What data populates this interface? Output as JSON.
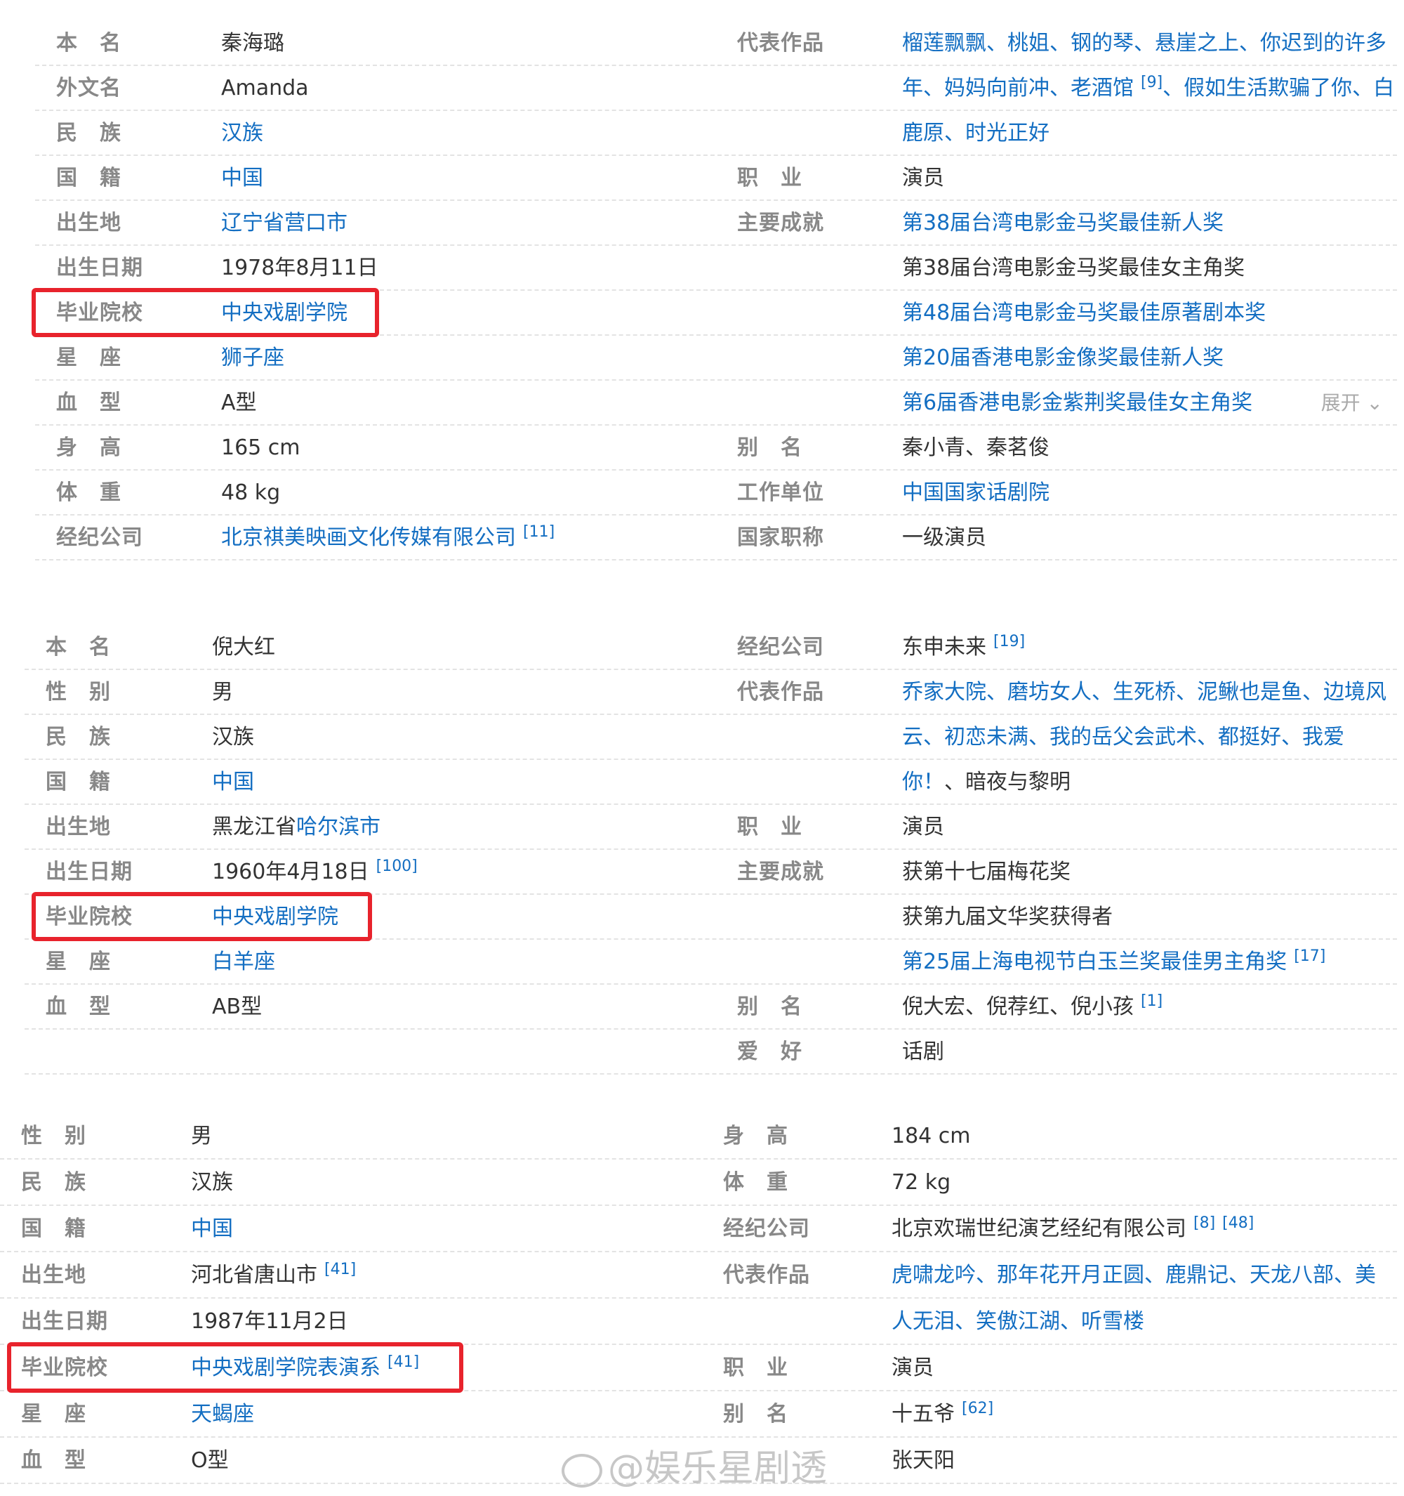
{
  "watermark": "@娱乐星剧透",
  "expand_label": "展开",
  "cards": [
    {
      "left": [
        {
          "label": "本　名",
          "value": "秦海璐",
          "link": false
        },
        {
          "label": "外文名",
          "value": "Amanda",
          "link": false
        },
        {
          "label": "民　族",
          "value": "汉族",
          "link": true
        },
        {
          "label": "国　籍",
          "value": "中国",
          "link": true
        },
        {
          "label": "出生地",
          "value": "辽宁省营口市",
          "link": true
        },
        {
          "label": "出生日期",
          "value": "1978年8月11日",
          "link": false
        },
        {
          "label": "毕业院校",
          "value": "中央戏剧学院",
          "link": true
        },
        {
          "label": "星　座",
          "value": "狮子座",
          "link": true
        },
        {
          "label": "血　型",
          "value": "A型",
          "link": false
        },
        {
          "label": "身　高",
          "value": "165 cm",
          "link": false
        },
        {
          "label": "体　重",
          "value": "48 kg",
          "link": false
        },
        {
          "label": "经纪公司",
          "value": "北京祺美映画文化传媒有限公司",
          "link": true,
          "ref": "[11]"
        }
      ],
      "right": [
        {
          "label": "代表作品",
          "value": "榴莲飘飘、桃姐、钢的琴、悬崖之上、你迟到的许多",
          "link": true
        },
        {
          "label": "",
          "value": "年、妈妈向前冲、老酒馆",
          "link": true,
          "ref": "[9]",
          "value2": "、假如生活欺骗了你、白"
        },
        {
          "label": "",
          "value": "鹿原、时光正好",
          "link": true
        },
        {
          "label": "职　业",
          "value": "演员",
          "link": false
        },
        {
          "label": "主要成就",
          "value": "第38届台湾电影金马奖最佳新人奖",
          "link": true
        },
        {
          "label": "",
          "value": "第38届台湾电影金马奖最佳女主角奖",
          "link": false
        },
        {
          "label": "",
          "value": "第48届台湾电影金马奖最佳原著剧本奖",
          "link": true
        },
        {
          "label": "",
          "value": "第20届香港电影金像奖最佳新人奖",
          "link": true
        },
        {
          "label": "",
          "value": "第6届香港电影金紫荆奖最佳女主角奖",
          "link": true,
          "expand": true
        },
        {
          "label": "别　名",
          "value": "秦小青、秦茗俊",
          "link": false
        },
        {
          "label": "工作单位",
          "value": "中国国家话剧院",
          "link": true
        },
        {
          "label": "国家职称",
          "value": "一级演员",
          "link": false
        }
      ]
    },
    {
      "left": [
        {
          "label": "本　名",
          "value": "倪大红",
          "link": false
        },
        {
          "label": "性　别",
          "value": "男",
          "link": false
        },
        {
          "label": "民　族",
          "value": "汉族",
          "link": false
        },
        {
          "label": "国　籍",
          "value": "中国",
          "link": true
        },
        {
          "label": "出生地",
          "value": "黑龙江省",
          "link": false,
          "value2": "哈尔滨市"
        },
        {
          "label": "出生日期",
          "value": "1960年4月18日",
          "link": false,
          "ref": "[100]"
        },
        {
          "label": "毕业院校",
          "value": "中央戏剧学院",
          "link": true
        },
        {
          "label": "星　座",
          "value": "白羊座",
          "link": true
        },
        {
          "label": "血　型",
          "value": "AB型",
          "link": false
        }
      ],
      "right": [
        {
          "label": "经纪公司",
          "value": "东申未来",
          "link": false,
          "ref": "[19]"
        },
        {
          "label": "代表作品",
          "value": "乔家大院、磨坊女人、生死桥、泥鳅也是鱼、边境风",
          "link": true
        },
        {
          "label": "",
          "value": "云、初恋未满、我的岳父会武术、都挺好、我爱",
          "link": true
        },
        {
          "label": "",
          "value": "你！",
          "link": true,
          "value2": "、暗夜与黎明"
        },
        {
          "label": "职　业",
          "value": "演员",
          "link": false
        },
        {
          "label": "主要成就",
          "value": "获第十七届梅花奖",
          "link": false
        },
        {
          "label": "",
          "value": "获第九届文华奖获得者",
          "link": false
        },
        {
          "label": "",
          "value": "第25届上海电视节白玉兰奖最佳男主角奖",
          "link": true,
          "ref": "[17]"
        },
        {
          "label": "别　名",
          "value": "倪大宏、倪荐红、倪小孩",
          "link": false,
          "ref": "[1]"
        },
        {
          "label": "爱　好",
          "value": "话剧",
          "link": false
        }
      ]
    },
    {
      "left": [
        {
          "label": "性　别",
          "value": "男",
          "link": false
        },
        {
          "label": "民　族",
          "value": "汉族",
          "link": false
        },
        {
          "label": "国　籍",
          "value": "中国",
          "link": true
        },
        {
          "label": "出生地",
          "value": "河北省唐山市",
          "link": false,
          "ref": "[41]"
        },
        {
          "label": "出生日期",
          "value": "1987年11月2日",
          "link": false
        },
        {
          "label": "毕业院校",
          "value": "中央戏剧学院表演系",
          "link": true,
          "ref": "[41]"
        },
        {
          "label": "星　座",
          "value": "天蝎座",
          "link": true
        },
        {
          "label": "血　型",
          "value": "O型",
          "link": false
        }
      ],
      "right": [
        {
          "label": "身　高",
          "value": "184 cm",
          "link": false
        },
        {
          "label": "体　重",
          "value": "72 kg",
          "link": false
        },
        {
          "label": "经纪公司",
          "value": "北京欢瑞世纪演艺经纪有限公司",
          "link": false,
          "ref": "[8]",
          "ref2": "[48]"
        },
        {
          "label": "代表作品",
          "value": "虎啸龙吟、那年花开月正圆、鹿鼎记、天龙八部、美",
          "link": true
        },
        {
          "label": "",
          "value": "人无泪、笑傲江湖、听雪楼",
          "link": true
        },
        {
          "label": "职　业",
          "value": "演员",
          "link": false
        },
        {
          "label": "别　名",
          "value": "十五爷",
          "link": false,
          "ref": "[62]"
        },
        {
          "label": "",
          "value": "张天阳",
          "link": false
        }
      ]
    }
  ]
}
